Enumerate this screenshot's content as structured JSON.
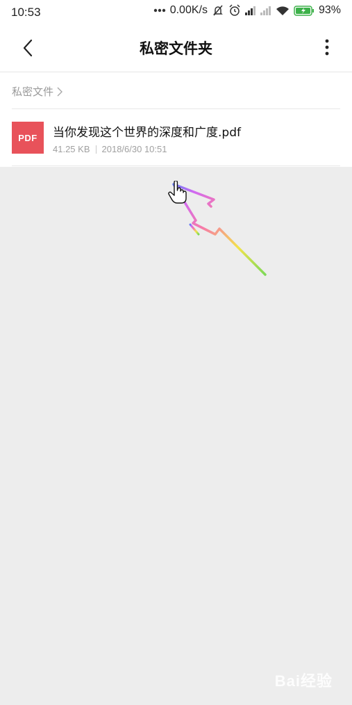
{
  "status": {
    "time": "10:53",
    "network_speed": "0.00K/s",
    "battery": "93%"
  },
  "header": {
    "title": "私密文件夹"
  },
  "breadcrumb": {
    "label": "私密文件"
  },
  "files": [
    {
      "name": "当你发现这个世界的深度和广度.pdf",
      "type_badge": "PDF",
      "size": "41.25 KB",
      "date": "2018/6/30 10:51"
    }
  ],
  "watermark": "Bai经验",
  "colors": {
    "pdf_badge": "#e8525a",
    "battery_fill": "#3db14a"
  }
}
